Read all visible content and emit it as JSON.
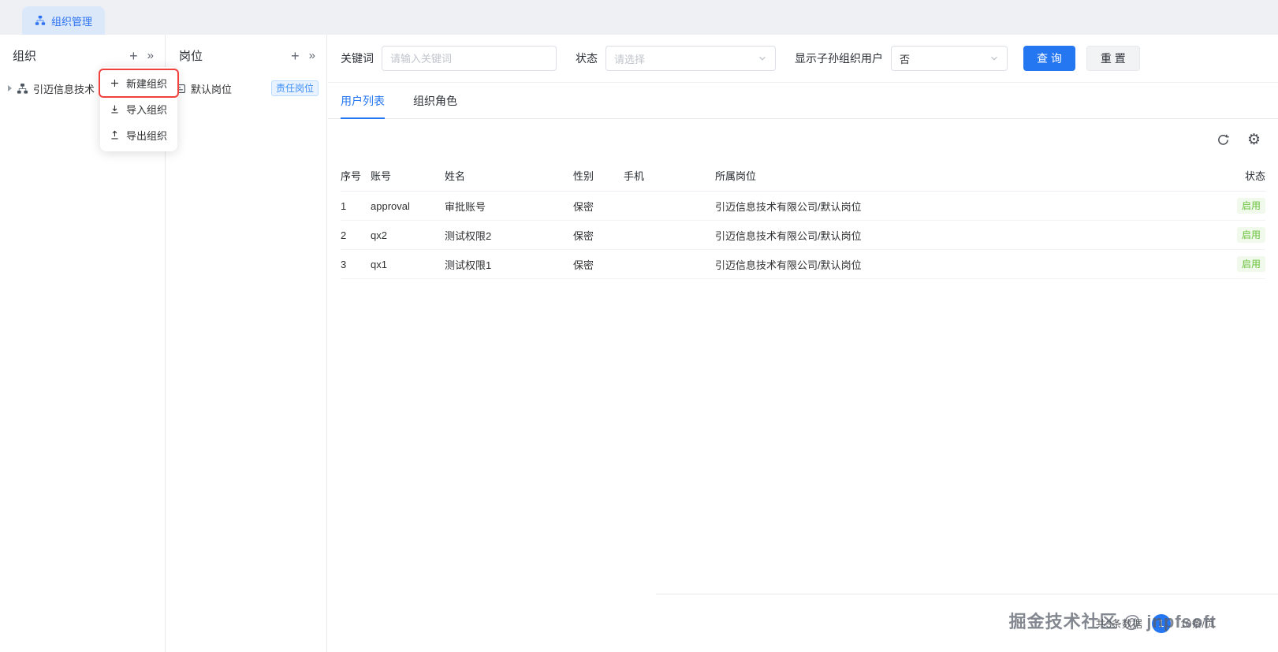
{
  "topbar": {
    "tab_label": "组织管理"
  },
  "icons": {
    "plus": "+",
    "collapse": "»",
    "gear": "⚙"
  },
  "org_panel": {
    "title": "组织",
    "tree_item": "引迈信息技术"
  },
  "context_menu": {
    "items": [
      {
        "label": "新建组织"
      },
      {
        "label": "导入组织"
      },
      {
        "label": "导出组织"
      }
    ]
  },
  "position_panel": {
    "title": "岗位",
    "item_label": "默认岗位",
    "item_tag": "责任岗位"
  },
  "filters": {
    "keyword_label": "关键词",
    "keyword_placeholder": "请输入关键词",
    "status_label": "状态",
    "status_placeholder": "请选择",
    "descendant_label": "显示子孙组织用户",
    "descendant_value": "否",
    "search_button": "查 询",
    "reset_button": "重 置"
  },
  "tabs": [
    {
      "label": "用户列表"
    },
    {
      "label": "组织角色"
    }
  ],
  "table": {
    "columns": [
      "序号",
      "账号",
      "姓名",
      "性别",
      "手机",
      "所属岗位",
      "状态"
    ],
    "rows": [
      {
        "index": "1",
        "account": "approval",
        "name": "审批账号",
        "gender": "保密",
        "phone": "",
        "position": "引迈信息技术有限公司/默认岗位",
        "status": "启用"
      },
      {
        "index": "2",
        "account": "qx2",
        "name": "测试权限2",
        "gender": "保密",
        "phone": "",
        "position": "引迈信息技术有限公司/默认岗位",
        "status": "启用"
      },
      {
        "index": "3",
        "account": "qx1",
        "name": "测试权限1",
        "gender": "保密",
        "phone": "",
        "position": "引迈信息技术有限公司/默认岗位",
        "status": "启用"
      }
    ]
  },
  "pagination": {
    "total": "共3条数据",
    "page": "1",
    "page_size": "10条/页"
  },
  "watermark": "掘金技术社区 @ jnpfsoft",
  "colors": {
    "primary": "#2476f1",
    "success": "#67c23a",
    "annotation": "#f0413c",
    "tab_bg": "#dbe8fa"
  }
}
